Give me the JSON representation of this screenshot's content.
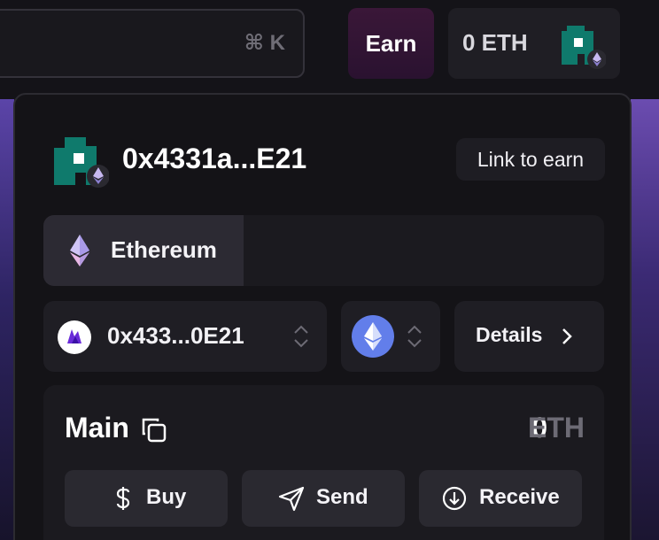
{
  "search": {
    "shortcut": "⌘ K"
  },
  "header": {
    "earn_label": "Earn",
    "balance_chip": "0 ETH"
  },
  "panel": {
    "address_title": "0x4331a...E21",
    "link_to_earn_label": "Link to earn",
    "network_tabs": [
      {
        "label": "Ethereum",
        "selected": true,
        "icon": "ethereum-diamond-icon"
      }
    ],
    "account_selector": {
      "value": "0x433...0E21",
      "icon": "wallet-logo-icon"
    },
    "chain_selector": {
      "icon": "ethereum-icon"
    },
    "details_label": "Details",
    "wallet": {
      "name": "Main",
      "balance_amount": "0",
      "balance_unit": "ETH",
      "actions": [
        {
          "label": "Buy",
          "icon": "dollar-icon"
        },
        {
          "label": "Send",
          "icon": "send-icon"
        },
        {
          "label": "Receive",
          "icon": "receive-icon"
        }
      ]
    }
  },
  "colors": {
    "background": "#141318",
    "avatar_teal": "#0f7a6c",
    "ethereum_blue": "#627eea",
    "earn_gradient": "#3a1738",
    "accent_purple": "#6b4cb0"
  }
}
